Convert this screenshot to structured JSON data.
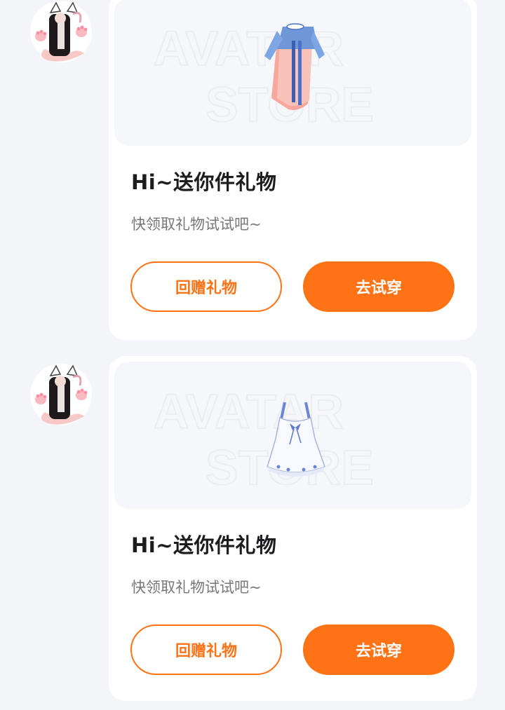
{
  "messages": [
    {
      "title": "Hi~送你件礼物",
      "subtitle": "快领取礼物试试吧~",
      "return_gift_label": "回赠礼物",
      "try_on_label": "去试穿",
      "item_icon": "hanfu-dress-icon",
      "watermark": [
        "AVATAR",
        "STORE"
      ]
    },
    {
      "title": "Hi~送你件礼物",
      "subtitle": "快领取礼物试试吧~",
      "return_gift_label": "回赠礼物",
      "try_on_label": "去试穿",
      "item_icon": "slip-dress-icon",
      "watermark": [
        "AVATAR",
        "STORE"
      ]
    }
  ],
  "colors": {
    "accent": "#ff7316",
    "background": "#f4f5f8",
    "card": "#ffffff",
    "preview_bg": "#f6f7fb",
    "title": "#1c1c1e",
    "subtitle": "#76777b"
  }
}
